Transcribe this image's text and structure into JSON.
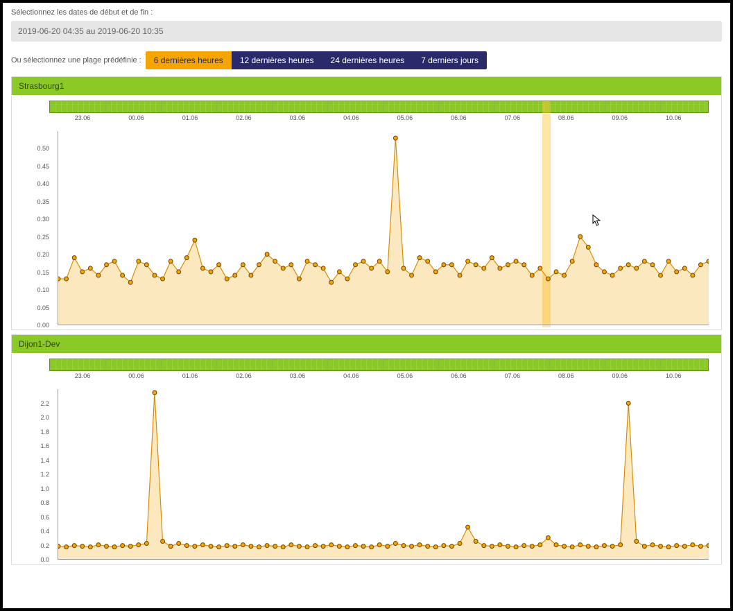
{
  "controls": {
    "date_label": "Sélectionnez les dates de début et de fin :",
    "date_value": "2019-06-20 04:35 au 2019-06-20 10:35",
    "preset_label": "Ou sélectionnez une plage prédéfinie :",
    "presets": [
      {
        "label": "6 dernières heures",
        "active": true
      },
      {
        "label": "12 dernières heures",
        "active": false
      },
      {
        "label": "24 dernières heures",
        "active": false
      },
      {
        "label": "7 derniers jours",
        "active": false
      }
    ]
  },
  "panels": [
    {
      "title": "Strasbourg1"
    },
    {
      "title": "Dijon1-Dev"
    }
  ],
  "time_labels": [
    "23.06",
    "00.06",
    "01.06",
    "02.06",
    "03.06",
    "04.06",
    "05.06",
    "06.06",
    "07.06",
    "08.06",
    "09.06",
    "10.06"
  ],
  "chart_data": [
    {
      "type": "area",
      "title": "Strasbourg1",
      "xlabel": "",
      "ylabel": "",
      "ylim": [
        0.0,
        0.55
      ],
      "y_ticks": [
        0.0,
        0.05,
        0.1,
        0.15,
        0.2,
        0.25,
        0.3,
        0.35,
        0.4,
        0.45,
        0.5
      ],
      "x_categories": [
        "23.06",
        "00.06",
        "01.06",
        "02.06",
        "03.06",
        "04.06",
        "05.06",
        "06.06",
        "07.06",
        "08.06",
        "09.06",
        "10.06"
      ],
      "highlight_x_index": 61,
      "values": [
        0.13,
        0.13,
        0.19,
        0.15,
        0.16,
        0.14,
        0.17,
        0.18,
        0.14,
        0.12,
        0.18,
        0.17,
        0.14,
        0.13,
        0.18,
        0.15,
        0.19,
        0.24,
        0.16,
        0.15,
        0.17,
        0.13,
        0.14,
        0.17,
        0.14,
        0.17,
        0.2,
        0.18,
        0.16,
        0.17,
        0.13,
        0.18,
        0.17,
        0.16,
        0.12,
        0.15,
        0.13,
        0.17,
        0.18,
        0.16,
        0.18,
        0.15,
        0.53,
        0.16,
        0.14,
        0.19,
        0.18,
        0.15,
        0.17,
        0.17,
        0.14,
        0.18,
        0.17,
        0.16,
        0.19,
        0.16,
        0.17,
        0.18,
        0.17,
        0.14,
        0.16,
        0.13,
        0.15,
        0.14,
        0.18,
        0.25,
        0.22,
        0.17,
        0.15,
        0.14,
        0.16,
        0.17,
        0.16,
        0.18,
        0.17,
        0.14,
        0.18,
        0.15,
        0.16,
        0.14,
        0.17,
        0.18
      ]
    },
    {
      "type": "area",
      "title": "Dijon1-Dev",
      "xlabel": "",
      "ylabel": "",
      "ylim": [
        0.0,
        2.4
      ],
      "y_ticks": [
        0.0,
        0.2,
        0.4,
        0.6,
        0.8,
        1.0,
        1.2,
        1.4,
        1.6,
        1.8,
        2.0,
        2.2
      ],
      "x_categories": [
        "23.06",
        "00.06",
        "01.06",
        "02.06",
        "03.06",
        "04.06",
        "05.06",
        "06.06",
        "07.06",
        "08.06",
        "09.06",
        "10.06"
      ],
      "values": [
        0.18,
        0.17,
        0.19,
        0.18,
        0.17,
        0.2,
        0.18,
        0.17,
        0.19,
        0.18,
        0.2,
        0.22,
        2.35,
        0.25,
        0.18,
        0.22,
        0.19,
        0.18,
        0.2,
        0.18,
        0.17,
        0.19,
        0.18,
        0.2,
        0.18,
        0.17,
        0.19,
        0.18,
        0.17,
        0.2,
        0.18,
        0.17,
        0.19,
        0.18,
        0.2,
        0.18,
        0.17,
        0.19,
        0.18,
        0.17,
        0.2,
        0.18,
        0.22,
        0.19,
        0.18,
        0.2,
        0.18,
        0.17,
        0.19,
        0.18,
        0.22,
        0.45,
        0.25,
        0.19,
        0.18,
        0.2,
        0.18,
        0.17,
        0.19,
        0.18,
        0.2,
        0.3,
        0.2,
        0.18,
        0.17,
        0.2,
        0.18,
        0.17,
        0.19,
        0.18,
        0.2,
        2.2,
        0.25,
        0.18,
        0.2,
        0.18,
        0.17,
        0.19,
        0.18,
        0.2,
        0.18,
        0.19
      ]
    }
  ],
  "colors": {
    "accent_active": "#f4a500",
    "accent_dark": "#2a2a6b",
    "panel_header": "#8bc926",
    "area_fill": "rgba(244,165,0,0.25)",
    "area_stroke": "#d98b00"
  }
}
